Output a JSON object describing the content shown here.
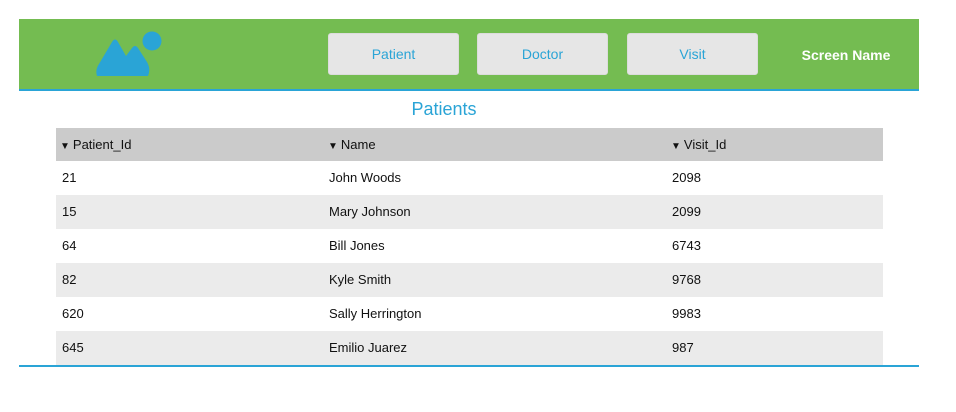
{
  "header": {
    "logo_icon": "image-placeholder-icon",
    "background_color": "#74bc51",
    "accent_color": "#2aa4d6",
    "nav": [
      {
        "label": "Patient"
      },
      {
        "label": "Doctor"
      },
      {
        "label": "Visit"
      }
    ],
    "screen_name": "Screen Name"
  },
  "main": {
    "title": "Patients",
    "table": {
      "sort_icon": "sort-down-icon",
      "columns": [
        "Patient_Id",
        "Name",
        "Visit_Id"
      ],
      "rows": [
        [
          "21",
          "John Woods",
          "2098"
        ],
        [
          "15",
          "Mary Johnson",
          "2099"
        ],
        [
          "64",
          "Bill Jones",
          "6743"
        ],
        [
          "82",
          "Kyle Smith",
          "9768"
        ],
        [
          "620",
          "Sally Herrington",
          "9983"
        ],
        [
          "645",
          "Emilio Juarez",
          "987"
        ]
      ]
    }
  }
}
